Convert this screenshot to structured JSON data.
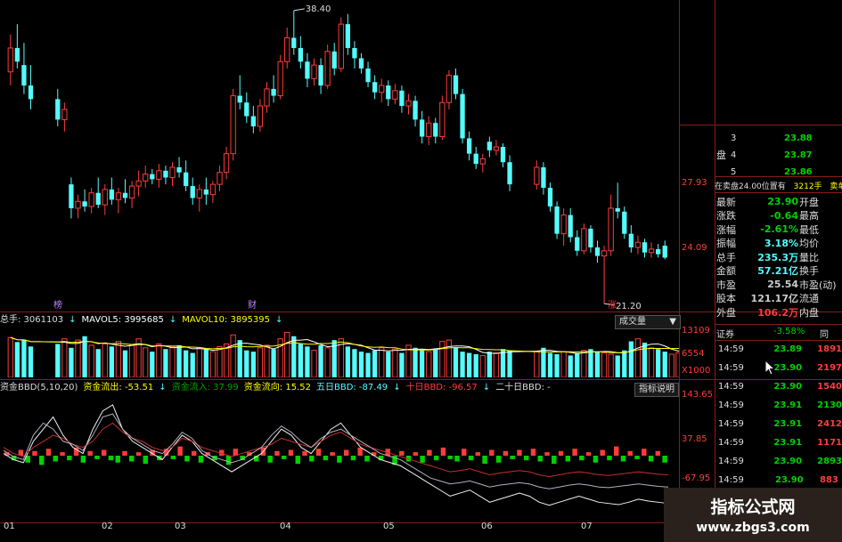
{
  "colors": {
    "up": "#ff3c3c",
    "down": "#54fcfc",
    "grid": "#8a1a1a",
    "yellow": "#ffff00",
    "white": "#ffffff",
    "green": "#00d200",
    "volup": "#ff3c3c",
    "voldown": "#54fcfc",
    "ma5": "#ffffff",
    "ma10": "#ffff00",
    "bbd_white": "#f0f0f0",
    "bbd_red": "#c03030",
    "bbd_gray": "#b0b0c0"
  },
  "price_axis": {
    "labels": [
      "27.93",
      "24.09"
    ]
  },
  "annotations": {
    "high": "38.40",
    "low": "21.20",
    "events": [
      {
        "label": "榜",
        "color": "#c080ff"
      },
      {
        "label": "财",
        "color": "#c080ff"
      },
      {
        "label": "涨",
        "color": "#ff3030"
      }
    ]
  },
  "candles": [
    {
      "o": 34.8,
      "h": 37.0,
      "l": 34.0,
      "c": 36.2
    },
    {
      "o": 36.2,
      "h": 37.6,
      "l": 35.0,
      "c": 35.4
    },
    {
      "o": 35.2,
      "h": 36.5,
      "l": 33.5,
      "c": 34.0
    },
    {
      "o": 34.0,
      "h": 35.2,
      "l": 32.6,
      "c": 33.2
    },
    {
      "o": 33.2,
      "h": 33.8,
      "l": 31.6,
      "c": 32.0
    },
    {
      "o": 32.0,
      "h": 33.0,
      "l": 31.3,
      "c": 32.6
    },
    {
      "o": 28.2,
      "h": 28.6,
      "l": 26.2,
      "c": 26.8
    },
    {
      "o": 26.8,
      "h": 27.6,
      "l": 26.2,
      "c": 27.2
    },
    {
      "o": 27.2,
      "h": 27.9,
      "l": 26.6,
      "c": 26.9
    },
    {
      "o": 26.9,
      "h": 28.0,
      "l": 26.5,
      "c": 27.7
    },
    {
      "o": 27.7,
      "h": 28.6,
      "l": 26.8,
      "c": 27.0
    },
    {
      "o": 27.0,
      "h": 28.2,
      "l": 26.4,
      "c": 27.9
    },
    {
      "o": 27.9,
      "h": 28.6,
      "l": 27.0,
      "c": 27.3
    },
    {
      "o": 27.3,
      "h": 28.0,
      "l": 26.5,
      "c": 27.7
    },
    {
      "o": 27.7,
      "h": 28.5,
      "l": 27.1,
      "c": 27.4
    },
    {
      "o": 27.4,
      "h": 28.4,
      "l": 26.8,
      "c": 28.1
    },
    {
      "o": 28.1,
      "h": 29.0,
      "l": 27.5,
      "c": 28.4
    },
    {
      "o": 28.4,
      "h": 29.3,
      "l": 28.0,
      "c": 28.8
    },
    {
      "o": 28.8,
      "h": 29.1,
      "l": 28.2,
      "c": 28.5
    },
    {
      "o": 28.5,
      "h": 29.4,
      "l": 28.0,
      "c": 29.0
    },
    {
      "o": 29.0,
      "h": 29.3,
      "l": 28.2,
      "c": 28.6
    },
    {
      "o": 28.6,
      "h": 29.5,
      "l": 28.1,
      "c": 29.2
    },
    {
      "o": 29.2,
      "h": 29.8,
      "l": 28.6,
      "c": 28.9
    },
    {
      "o": 28.9,
      "h": 29.6,
      "l": 27.8,
      "c": 28.1
    },
    {
      "o": 28.1,
      "h": 28.6,
      "l": 27.0,
      "c": 27.4
    },
    {
      "o": 27.4,
      "h": 28.2,
      "l": 26.6,
      "c": 27.9
    },
    {
      "o": 27.9,
      "h": 28.6,
      "l": 27.0,
      "c": 27.6
    },
    {
      "o": 27.6,
      "h": 28.4,
      "l": 27.1,
      "c": 28.2
    },
    {
      "o": 28.2,
      "h": 29.3,
      "l": 27.8,
      "c": 28.9
    },
    {
      "o": 28.9,
      "h": 30.4,
      "l": 28.5,
      "c": 30.0
    },
    {
      "o": 30.0,
      "h": 33.8,
      "l": 29.6,
      "c": 33.4
    },
    {
      "o": 33.4,
      "h": 34.6,
      "l": 32.6,
      "c": 33.0
    },
    {
      "o": 33.0,
      "h": 33.6,
      "l": 31.8,
      "c": 32.2
    },
    {
      "o": 32.2,
      "h": 32.8,
      "l": 31.2,
      "c": 31.6
    },
    {
      "o": 31.6,
      "h": 33.2,
      "l": 31.3,
      "c": 32.8
    },
    {
      "o": 32.8,
      "h": 34.2,
      "l": 32.4,
      "c": 33.8
    },
    {
      "o": 33.8,
      "h": 34.6,
      "l": 33.0,
      "c": 33.4
    },
    {
      "o": 33.4,
      "h": 35.8,
      "l": 33.2,
      "c": 35.4
    },
    {
      "o": 35.4,
      "h": 37.4,
      "l": 35.0,
      "c": 36.8
    },
    {
      "o": 36.8,
      "h": 38.4,
      "l": 35.8,
      "c": 36.2
    },
    {
      "o": 36.2,
      "h": 36.9,
      "l": 35.0,
      "c": 35.4
    },
    {
      "o": 35.4,
      "h": 35.9,
      "l": 33.9,
      "c": 34.4
    },
    {
      "o": 34.4,
      "h": 35.6,
      "l": 34.0,
      "c": 35.2
    },
    {
      "o": 35.2,
      "h": 35.6,
      "l": 33.5,
      "c": 34.0
    },
    {
      "o": 34.0,
      "h": 36.4,
      "l": 33.8,
      "c": 36.0
    },
    {
      "o": 36.0,
      "h": 36.5,
      "l": 34.6,
      "c": 35.0
    },
    {
      "o": 35.0,
      "h": 38.0,
      "l": 34.8,
      "c": 37.6
    },
    {
      "o": 37.6,
      "h": 38.2,
      "l": 35.8,
      "c": 36.2
    },
    {
      "o": 36.2,
      "h": 36.6,
      "l": 35.0,
      "c": 35.6
    },
    {
      "o": 35.6,
      "h": 35.9,
      "l": 34.7,
      "c": 35.0
    },
    {
      "o": 35.0,
      "h": 35.4,
      "l": 33.9,
      "c": 34.2
    },
    {
      "o": 34.2,
      "h": 34.6,
      "l": 33.2,
      "c": 33.6
    },
    {
      "o": 33.6,
      "h": 34.4,
      "l": 33.0,
      "c": 34.0
    },
    {
      "o": 34.0,
      "h": 34.3,
      "l": 32.8,
      "c": 33.2
    },
    {
      "o": 33.2,
      "h": 34.1,
      "l": 32.9,
      "c": 33.7
    },
    {
      "o": 33.7,
      "h": 34.0,
      "l": 32.4,
      "c": 32.8
    },
    {
      "o": 32.8,
      "h": 33.5,
      "l": 32.3,
      "c": 33.1
    },
    {
      "o": 33.1,
      "h": 33.4,
      "l": 31.6,
      "c": 32.0
    },
    {
      "o": 32.0,
      "h": 32.5,
      "l": 30.6,
      "c": 31.0
    },
    {
      "o": 31.0,
      "h": 32.2,
      "l": 30.5,
      "c": 31.8
    },
    {
      "o": 31.8,
      "h": 32.1,
      "l": 30.6,
      "c": 31.0
    },
    {
      "o": 31.0,
      "h": 33.4,
      "l": 30.8,
      "c": 33.0
    },
    {
      "o": 33.0,
      "h": 34.9,
      "l": 32.6,
      "c": 34.6
    },
    {
      "o": 34.6,
      "h": 35.0,
      "l": 33.2,
      "c": 33.5
    },
    {
      "o": 33.5,
      "h": 33.8,
      "l": 30.6,
      "c": 30.9
    },
    {
      "o": 30.9,
      "h": 31.3,
      "l": 29.6,
      "c": 30.0
    },
    {
      "o": 30.0,
      "h": 30.4,
      "l": 29.1,
      "c": 29.4
    },
    {
      "o": 29.4,
      "h": 30.0,
      "l": 28.9,
      "c": 29.7
    },
    {
      "o": 30.7,
      "h": 31.0,
      "l": 29.8,
      "c": 30.2
    },
    {
      "o": 30.2,
      "h": 30.8,
      "l": 29.9,
      "c": 30.4
    },
    {
      "o": 30.4,
      "h": 30.6,
      "l": 29.2,
      "c": 29.5
    },
    {
      "o": 29.5,
      "h": 29.9,
      "l": 27.8,
      "c": 28.2
    },
    {
      "o": 28.2,
      "h": 29.6,
      "l": 27.9,
      "c": 29.2
    },
    {
      "o": 29.2,
      "h": 29.5,
      "l": 27.6,
      "c": 28.0
    },
    {
      "o": 28.0,
      "h": 28.3,
      "l": 26.6,
      "c": 26.9
    },
    {
      "o": 26.9,
      "h": 27.2,
      "l": 25.0,
      "c": 25.3
    },
    {
      "o": 25.3,
      "h": 26.8,
      "l": 24.6,
      "c": 26.4
    },
    {
      "o": 26.4,
      "h": 26.8,
      "l": 24.8,
      "c": 25.1
    },
    {
      "o": 25.1,
      "h": 25.5,
      "l": 24.0,
      "c": 24.3
    },
    {
      "o": 24.3,
      "h": 25.9,
      "l": 24.1,
      "c": 25.6
    },
    {
      "o": 25.6,
      "h": 25.8,
      "l": 24.2,
      "c": 24.5
    },
    {
      "o": 24.5,
      "h": 24.9,
      "l": 23.6,
      "c": 24.0
    },
    {
      "o": 24.0,
      "h": 24.6,
      "l": 21.2,
      "c": 24.3
    },
    {
      "o": 24.3,
      "h": 27.6,
      "l": 24.0,
      "c": 26.8
    },
    {
      "o": 26.8,
      "h": 28.3,
      "l": 26.2,
      "c": 26.6
    },
    {
      "o": 26.6,
      "h": 26.9,
      "l": 25.0,
      "c": 25.3
    },
    {
      "o": 25.3,
      "h": 25.8,
      "l": 24.2,
      "c": 24.5
    },
    {
      "o": 24.5,
      "h": 25.2,
      "l": 24.1,
      "c": 24.8
    },
    {
      "o": 24.8,
      "h": 25.0,
      "l": 23.9,
      "c": 24.2
    },
    {
      "o": 24.2,
      "h": 24.8,
      "l": 23.9,
      "c": 24.4
    },
    {
      "o": 24.4,
      "h": 24.7,
      "l": 23.9,
      "c": 24.1
    },
    {
      "o": 24.6,
      "h": 24.9,
      "l": 23.8,
      "c": 23.9
    }
  ],
  "gaps": [
    4,
    72
  ],
  "vol_header": {
    "total": "总手: 3061103",
    "ma5": "MAVOL5: 3995685",
    "ma10": "MAVOL10: 3895395",
    "button": "成交量",
    "arrow": "▼"
  },
  "vol_axis": {
    "labels": [
      "13109",
      "6554",
      "X1000"
    ]
  },
  "volumes": [
    62,
    55,
    58,
    48,
    52,
    60,
    46,
    58,
    64,
    50,
    44,
    52,
    48,
    56,
    42,
    50,
    60,
    46,
    40,
    52,
    44,
    48,
    50,
    42,
    38,
    46,
    44,
    40,
    48,
    52,
    66,
    58,
    42,
    40,
    46,
    50,
    44,
    60,
    70,
    64,
    52,
    48,
    42,
    50,
    46,
    58,
    60,
    48,
    44,
    40,
    38,
    42,
    46,
    40,
    44,
    38,
    50,
    46,
    42,
    40,
    44,
    56,
    58,
    46,
    40,
    38,
    36,
    34,
    40,
    38,
    44,
    42,
    40,
    46,
    38,
    36,
    40,
    34,
    38,
    42,
    44,
    40,
    38,
    36,
    34,
    42,
    56,
    60,
    54,
    46,
    44,
    40,
    36,
    38,
    32,
    34
  ],
  "bbd_header": {
    "title": "资金BBD(5,10,20)",
    "inflow_label": "资金流出: -53.51",
    "outflow_label": "资金流入: 37.99",
    "direction_label": "资金流向: 15.52",
    "d5": "五日BBD: -87.49",
    "d10": "十日BBD: -96.57",
    "d20": "二十日BBD: -",
    "button": "指标说明"
  },
  "bbd_axis": {
    "labels": [
      "143.65",
      "37.85",
      "-67.95"
    ]
  },
  "bbd_bars": [
    3,
    -4,
    5,
    -6,
    4,
    -8,
    6,
    -5,
    3,
    -4,
    7,
    -6,
    4,
    -3,
    5,
    -4,
    -6,
    4,
    -5,
    3,
    -7,
    5,
    -4,
    6,
    -3,
    8,
    -5,
    4,
    -6,
    3,
    -4,
    5,
    -8,
    6,
    -4,
    3,
    -5,
    7,
    -6,
    4,
    -3,
    5,
    -7,
    4,
    -5,
    6,
    -4,
    3,
    -6,
    5,
    -4,
    7,
    -5,
    3,
    -4,
    6,
    -8,
    4,
    -5,
    3,
    -6,
    5,
    -4,
    7,
    -3,
    -5,
    6,
    -4,
    3,
    -7,
    5,
    -6,
    4,
    -3,
    5,
    -4,
    6,
    -5,
    3,
    -7,
    4,
    -5,
    6,
    -4,
    3,
    -6,
    5,
    -4,
    8,
    -5,
    4,
    -3,
    6,
    -5,
    4,
    -6
  ],
  "bbd_series": {
    "white": [
      20,
      10,
      5,
      40,
      60,
      80,
      50,
      30,
      20,
      60,
      90,
      100,
      60,
      40,
      30,
      20,
      10,
      30,
      50,
      40,
      20,
      10,
      0,
      -10,
      0,
      10,
      20,
      40,
      60,
      50,
      30,
      20,
      40,
      60,
      70,
      50,
      30,
      20,
      10,
      5,
      0,
      -10,
      -20,
      -30,
      -40,
      -50,
      -45,
      -40,
      -50,
      -60,
      -55,
      -50,
      -45,
      -50,
      -60,
      -65,
      -60,
      -55,
      -50,
      -55,
      -60,
      -62,
      -64,
      -60,
      -55,
      -58,
      -60,
      -62
    ],
    "red": [
      30,
      20,
      15,
      30,
      40,
      50,
      45,
      35,
      30,
      40,
      60,
      70,
      55,
      45,
      40,
      30,
      25,
      30,
      45,
      40,
      30,
      25,
      20,
      15,
      20,
      25,
      30,
      35,
      45,
      40,
      35,
      30,
      40,
      50,
      55,
      45,
      35,
      30,
      25,
      20,
      15,
      10,
      5,
      0,
      -5,
      -10,
      -8,
      -5,
      -10,
      -15,
      -12,
      -10,
      -8,
      -10,
      -15,
      -18,
      -15,
      -12,
      -10,
      -12,
      -15,
      -16,
      -14,
      -12,
      -10,
      -12,
      -14,
      -15
    ],
    "gray": [
      25,
      15,
      10,
      50,
      70,
      60,
      40,
      35,
      25,
      50,
      80,
      85,
      60,
      45,
      35,
      25,
      20,
      35,
      55,
      45,
      25,
      15,
      10,
      5,
      10,
      20,
      30,
      50,
      65,
      55,
      40,
      30,
      45,
      55,
      60,
      50,
      40,
      30,
      20,
      15,
      10,
      0,
      -10,
      -20,
      -25,
      -30,
      -28,
      -25,
      -30,
      -35,
      -32,
      -30,
      -28,
      -30,
      -35,
      -38,
      -35,
      -32,
      -30,
      -32,
      -35,
      -36,
      -34,
      -32,
      -30,
      -32,
      -34,
      -35
    ]
  },
  "date_axis": {
    "labels": [
      "01",
      "02",
      "03",
      "04",
      "05",
      "06",
      "07"
    ]
  },
  "orderbook": [
    {
      "level": "3",
      "price": "23.88"
    },
    {
      "level": "4",
      "price": "23.87"
    },
    {
      "level": "5",
      "price": "23.86"
    }
  ],
  "side_label": "盘",
  "sell_order": {
    "text": "在卖盘24.00位置有",
    "vol": "3212手",
    "tag": "卖单"
  },
  "stats": [
    {
      "k": "最新",
      "v": "23.90",
      "v_color": "#00d200",
      "k2": "开盘"
    },
    {
      "k": "涨跌",
      "v": "-0.64",
      "v_color": "#00d200",
      "k2": "最高"
    },
    {
      "k": "涨幅",
      "v": "-2.61%",
      "v_color": "#00d200",
      "k2": "最低"
    },
    {
      "k": "振幅",
      "v": "3.18%",
      "v_color": "#54fcfc",
      "k2": "均价"
    },
    {
      "k": "总手",
      "v": "235.3万",
      "v_color": "#54fcfc",
      "k2": "量比"
    },
    {
      "k": "金额",
      "v": "57.21亿",
      "v_color": "#54fcfc",
      "k2": "换手"
    },
    {
      "k": "市盈",
      "v": "25.54",
      "v_color": "#cccccc",
      "k2": "市盈(动)"
    },
    {
      "k": "股本",
      "v": "121.17亿",
      "v_color": "#cccccc",
      "k2": "流通"
    },
    {
      "k": "外盘",
      "v": "106.2万",
      "v_color": "#ff3c3c",
      "k2": "内盘"
    }
  ],
  "ticker_header": {
    "left": "证券",
    "mid": "-3.58%",
    "right": "同"
  },
  "ticks": [
    {
      "t": "14:59",
      "p": "23.89",
      "v": "1891"
    },
    {
      "t": "14:59",
      "p": "23.90",
      "v": "2197"
    },
    {
      "t": "14:59",
      "p": "23.90",
      "v": "1540"
    },
    {
      "t": "14:59",
      "p": "23.91",
      "v": "2130"
    },
    {
      "t": "14:59",
      "p": "23.91",
      "v": "2412"
    },
    {
      "t": "14:59",
      "p": "23.91",
      "v": "1171"
    },
    {
      "t": "14:59",
      "p": "23.90",
      "v": "2893"
    },
    {
      "t": "14:59",
      "p": "23.90",
      "v": "883"
    }
  ],
  "watermark": {
    "title": "指标公式网",
    "url": "www.zbgs3.com"
  }
}
